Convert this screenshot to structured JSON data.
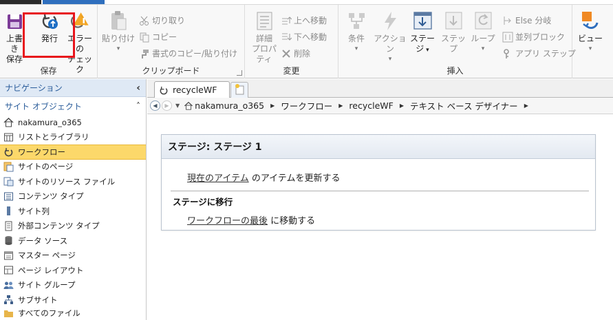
{
  "ribbon": {
    "groups": {
      "save": "保存",
      "clipboard": "クリップボード",
      "change": "変更",
      "insert": "挿入"
    },
    "buttons": {
      "save_line1": "上書き",
      "save_line2": "保存",
      "publish": "発行",
      "errorcheck_line1": "エラーの",
      "errorcheck_line2": "チェック",
      "paste": "貼り付け",
      "cut": "切り取り",
      "copy": "コピー",
      "format_copy": "書式のコピー/貼り付け",
      "details_line1": "詳細",
      "details_line2": "プロパティ",
      "move_up": "上へ移動",
      "move_down": "下へ移動",
      "delete": "削除",
      "condition": "条件",
      "action": "アクション",
      "stage_line1": "ステー",
      "stage_line2": "ジ",
      "step": "ステップ",
      "loop": "ループ",
      "else_branch": "Else 分岐",
      "parallel_block": "並列ブロック",
      "app_step": "アプリ ステップ",
      "view": "ビュー"
    }
  },
  "nav": {
    "header": "ナビゲーション",
    "collapse_glyph": "‹",
    "section": "サイト オブジェクト",
    "section_glyph": "˄",
    "items": [
      {
        "label": "nakamura_o365"
      },
      {
        "label": "リストとライブラリ"
      },
      {
        "label": "ワークフロー"
      },
      {
        "label": "サイトのページ"
      },
      {
        "label": "サイトのリソース ファイル"
      },
      {
        "label": "コンテンツ タイプ"
      },
      {
        "label": "サイト列"
      },
      {
        "label": "外部コンテンツ タイプ"
      },
      {
        "label": "データ ソース"
      },
      {
        "label": "マスター ページ"
      },
      {
        "label": "ページ レイアウト"
      },
      {
        "label": "サイト グループ"
      },
      {
        "label": "サブサイト"
      },
      {
        "label": "すべてのファイル"
      }
    ]
  },
  "tabs": {
    "doc": "recycleWF"
  },
  "breadcrumb": {
    "items": [
      "nakamura_o365",
      "ワークフロー",
      "recycleWF",
      "テキスト ベース デザイナー"
    ]
  },
  "stage": {
    "title": "ステージ: ステージ 1",
    "action1_link": "現在のアイテム",
    "action1_text": " のアイテムを更新する",
    "transition_label": "ステージに移行",
    "action2_link": "ワークフローの最後",
    "action2_text": " に移動する"
  },
  "colors": {
    "highlight": "#e8141b",
    "selected": "#fcd86a",
    "nav_accent": "#2a5c9a"
  }
}
